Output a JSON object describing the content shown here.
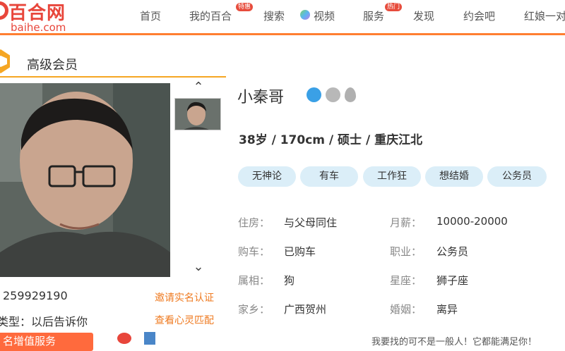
{
  "header": {
    "logo_cn": "百合网",
    "logo_en": "baihe.com",
    "nav": [
      {
        "label": "首页"
      },
      {
        "label": "我的百合",
        "badge": "特惠"
      },
      {
        "label": "搜索"
      },
      {
        "label": "视频"
      },
      {
        "label": "服务",
        "badge": "热门"
      },
      {
        "label": "发现"
      },
      {
        "label": "约会吧"
      },
      {
        "label": "红娘一对"
      }
    ]
  },
  "vip": {
    "title": "高级会员"
  },
  "gallery": {
    "up_arrow": "⌃",
    "down_arrow": "⌄",
    "user_id": "259929190",
    "blood_type": "类型：以后告诉你",
    "verify_link": "邀请实名认证",
    "match_link": "查看心灵匹配"
  },
  "profile": {
    "name": "小秦哥",
    "basic_info": "38岁 / 170cm / 硕士 / 重庆江北",
    "tags": [
      "无神论",
      "有车",
      "工作狂",
      "想结婚",
      "公务员"
    ],
    "details_left": [
      {
        "label": "住房：",
        "value": "与父母同住"
      },
      {
        "label": "购车：",
        "value": "已购车"
      },
      {
        "label": "属相：",
        "value": "狗"
      },
      {
        "label": "家乡：",
        "value": "广西贺州"
      }
    ],
    "details_right": [
      {
        "label": "月薪：",
        "value": "10000-20000"
      },
      {
        "label": "职业：",
        "value": "公务员"
      },
      {
        "label": "星座：",
        "value": "狮子座"
      },
      {
        "label": "婚姻：",
        "value": "离异"
      }
    ]
  },
  "bottom": {
    "service_button": "名增值服务",
    "slogan": "我要找的可不是一般人！它都能满足你！"
  },
  "colors": {
    "brand": "#e8463b",
    "accent": "#ff7e31",
    "tag_bg": "#dbeef8",
    "link": "#ef7b22"
  }
}
